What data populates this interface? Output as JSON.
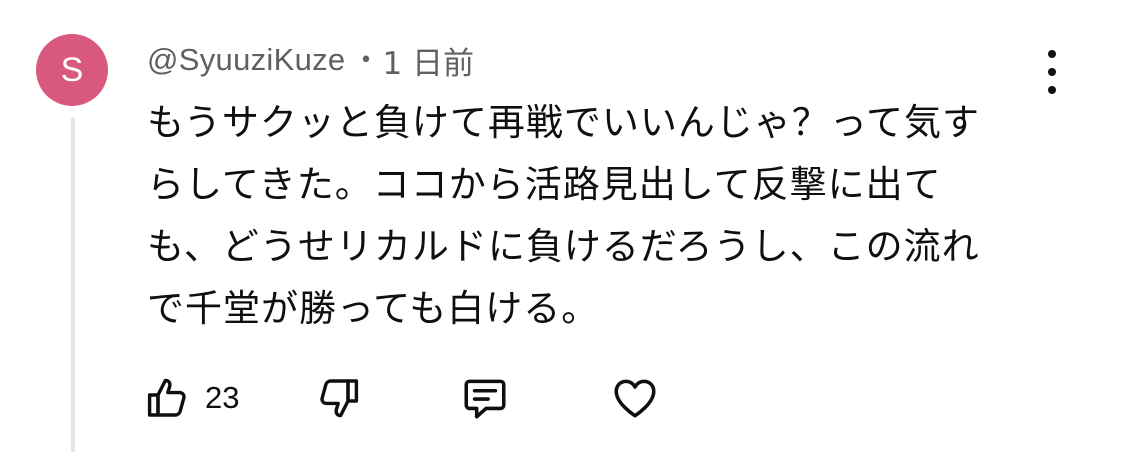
{
  "comment": {
    "avatar_initial": "S",
    "avatar_color": "#d9587d",
    "author": "@SyuuziKuze",
    "separator": "•",
    "time_ago": "1 日前",
    "text_lines": [
      "もうサクッと負けて再戦でいいんじゃ？って気す",
      "らしてきた。ココから活路見出して反撃に出て",
      "も、どうせリカルドに負けるだろうし、この流れ",
      "で千堂が勝っても白ける。"
    ],
    "like_count": "23",
    "icons": {
      "menu": "more-vertical-icon",
      "like": "thumbs-up-icon",
      "dislike": "thumbs-down-icon",
      "reply": "reply-comment-icon",
      "heart": "heart-icon"
    }
  }
}
